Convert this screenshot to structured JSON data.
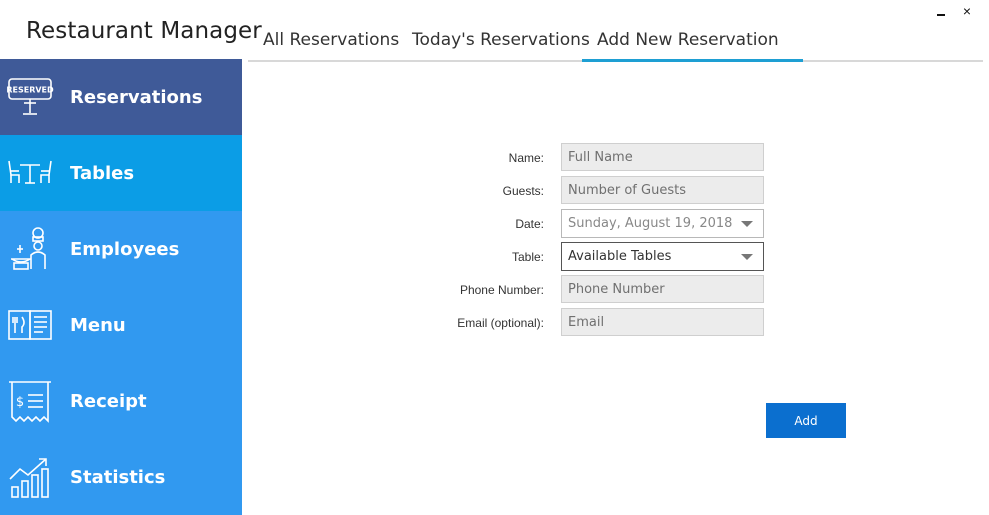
{
  "app": {
    "title": "Restaurant Manager"
  },
  "window": {
    "minimize_label": "_",
    "close_label": "×"
  },
  "sidebar": {
    "items": [
      {
        "label": "Reservations",
        "icon": "reserved-sign-icon"
      },
      {
        "label": "Tables",
        "icon": "table-chairs-icon"
      },
      {
        "label": "Employees",
        "icon": "chef-icon"
      },
      {
        "label": "Menu",
        "icon": "menu-book-icon"
      },
      {
        "label": "Receipt",
        "icon": "receipt-icon"
      },
      {
        "label": "Statistics",
        "icon": "growth-chart-icon"
      }
    ],
    "reserved_sign_text": "RESERVED"
  },
  "tabs": [
    {
      "label": "All Reservations"
    },
    {
      "label": "Today's Reservations"
    },
    {
      "label": "Add New Reservation"
    }
  ],
  "form": {
    "name": {
      "label": "Name:",
      "placeholder": "Full Name"
    },
    "guests": {
      "label": "Guests:",
      "placeholder": "Number of Guests"
    },
    "date": {
      "label": "Date:",
      "value": "Sunday, August 19, 2018"
    },
    "table": {
      "label": "Table:",
      "value": "Available Tables"
    },
    "phone": {
      "label": "Phone Number:",
      "placeholder": "Phone Number"
    },
    "email": {
      "label": "Email (optional):",
      "placeholder": "Email"
    },
    "submit_label": "Add"
  },
  "colors": {
    "sidebar_selected": "#3f5a98",
    "sidebar_hover": "#0b9de6",
    "sidebar_default": "#3199f0",
    "tab_active_underline": "#1e9fd3",
    "button_primary": "#0b6fcf"
  }
}
